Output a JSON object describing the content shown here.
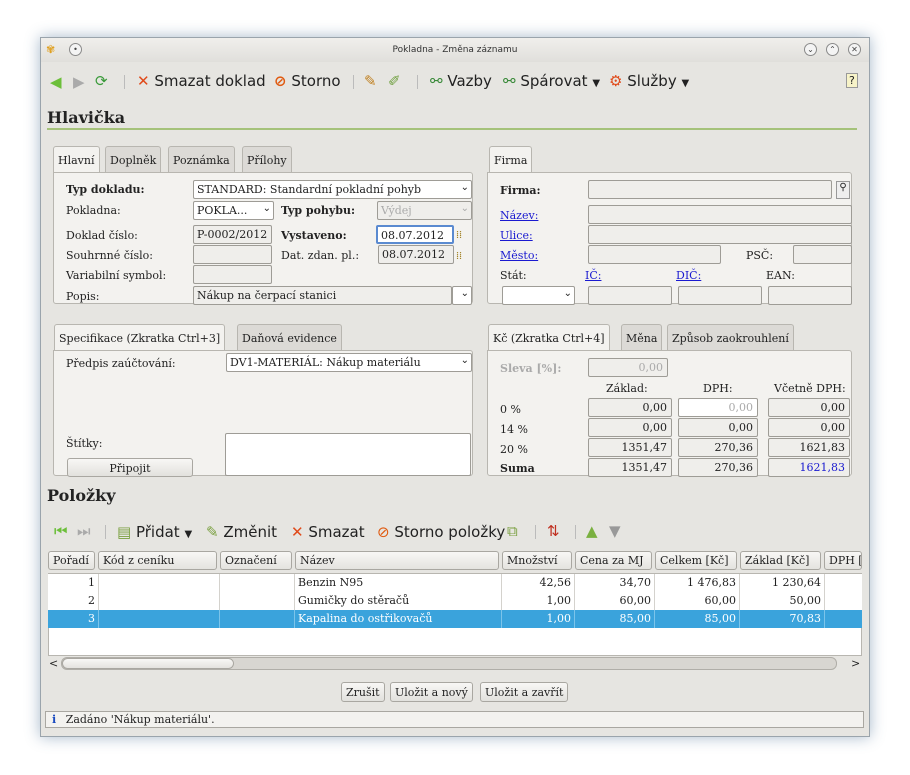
{
  "window": {
    "title": "Pokladna - Změna záznamu"
  },
  "toolbar": {
    "delete": "Smazat doklad",
    "storno": "Storno",
    "vazby": "Vazby",
    "sparovat": "Spárovat",
    "sluzby": "Služby"
  },
  "header": {
    "title": "Hlavička",
    "tabs": [
      "Hlavní",
      "Doplněk",
      "Poznámka",
      "Přílohy"
    ],
    "firma_tab": "Firma",
    "typ_dokladu_label": "Typ dokladu:",
    "typ_dokladu": "STANDARD: Standardní pokladní pohyb",
    "pokladna_label": "Pokladna:",
    "pokladna": "POKLA...",
    "typ_pohybu_label": "Typ pohybu:",
    "typ_pohybu": "Výdej",
    "doklad_cislo_label": "Doklad číslo:",
    "doklad_cislo": "P-0002/2012",
    "vystaveno_label": "Vystaveno:",
    "vystaveno": "08.07.2012",
    "souhrnne_label": "Souhrnné číslo:",
    "souhrnne": "",
    "dat_zdan_label": "Dat. zdan. pl.:",
    "dat_zdan": "08.07.2012",
    "variabilni_label": "Variabilní symbol:",
    "variabilni": "",
    "popis_label": "Popis:",
    "popis": "Nákup na čerpací stanici",
    "firma_label": "Firma:",
    "nazev_label": "Název:",
    "ulice_label": "Ulice:",
    "mesto_label": "Město:",
    "psc_label": "PSČ:",
    "stat_label": "Stát:",
    "ic_label": "IČ:",
    "dic_label": "DIČ:",
    "ean_label": "EAN:"
  },
  "spec": {
    "tabs": [
      "Specifikace (Zkratka Ctrl+3]",
      "Daňová evidence"
    ],
    "predpis_label": "Předpis zaúčtování:",
    "predpis": "DV1-MATERIÁL: Nákup materiálu",
    "stitky_label": "Štítky:",
    "pripojit": "Připojit"
  },
  "sum": {
    "tabs": [
      "Kč (Zkratka Ctrl+4]",
      "Měna",
      "Způsob zaokrouhlení"
    ],
    "sleva_label": "Sleva [%]:",
    "sleva": "0,00",
    "cols": [
      "Základ:",
      "DPH:",
      "Včetně DPH:"
    ],
    "rows": [
      {
        "label": "0 %",
        "zaklad": "0,00",
        "dph": "0,00",
        "celkem": "0,00"
      },
      {
        "label": "14 %",
        "zaklad": "0,00",
        "dph": "0,00",
        "celkem": "0,00"
      },
      {
        "label": "20 %",
        "zaklad": "1351,47",
        "dph": "270,36",
        "celkem": "1621,83"
      },
      {
        "label": "Suma",
        "zaklad": "1351,47",
        "dph": "270,36",
        "celkem": "1621,83"
      }
    ]
  },
  "items": {
    "title": "Položky",
    "toolbar": {
      "add": "Přidat",
      "edit": "Změnit",
      "delete": "Smazat",
      "storno": "Storno položky"
    },
    "columns": [
      "Pořadí",
      "Kód z ceníku",
      "Označení",
      "Název",
      "Množství",
      "Cena za MJ",
      "Celkem [Kč]",
      "Základ [Kč]",
      "DPH ["
    ],
    "rows": [
      {
        "poradi": "1",
        "kod": "",
        "oznaceni": "",
        "nazev": "Benzin N95",
        "mnozstvi": "42,56",
        "cena": "34,70",
        "celkem": "1 476,83",
        "zaklad": "1 230,64"
      },
      {
        "poradi": "2",
        "kod": "",
        "oznaceni": "",
        "nazev": "Gumičky do stěračů",
        "mnozstvi": "1,00",
        "cena": "60,00",
        "celkem": "60,00",
        "zaklad": "50,00"
      },
      {
        "poradi": "3",
        "kod": "",
        "oznaceni": "",
        "nazev": "Kapalina do ostřikovačů",
        "mnozstvi": "1,00",
        "cena": "85,00",
        "celkem": "85,00",
        "zaklad": "70,83"
      }
    ]
  },
  "buttons": {
    "cancel": "Zrušit",
    "save_new": "Uložit a nový",
    "save_close": "Uložit a zavřít"
  },
  "status": {
    "text": "Zadáno 'Nákup materiálu'."
  }
}
